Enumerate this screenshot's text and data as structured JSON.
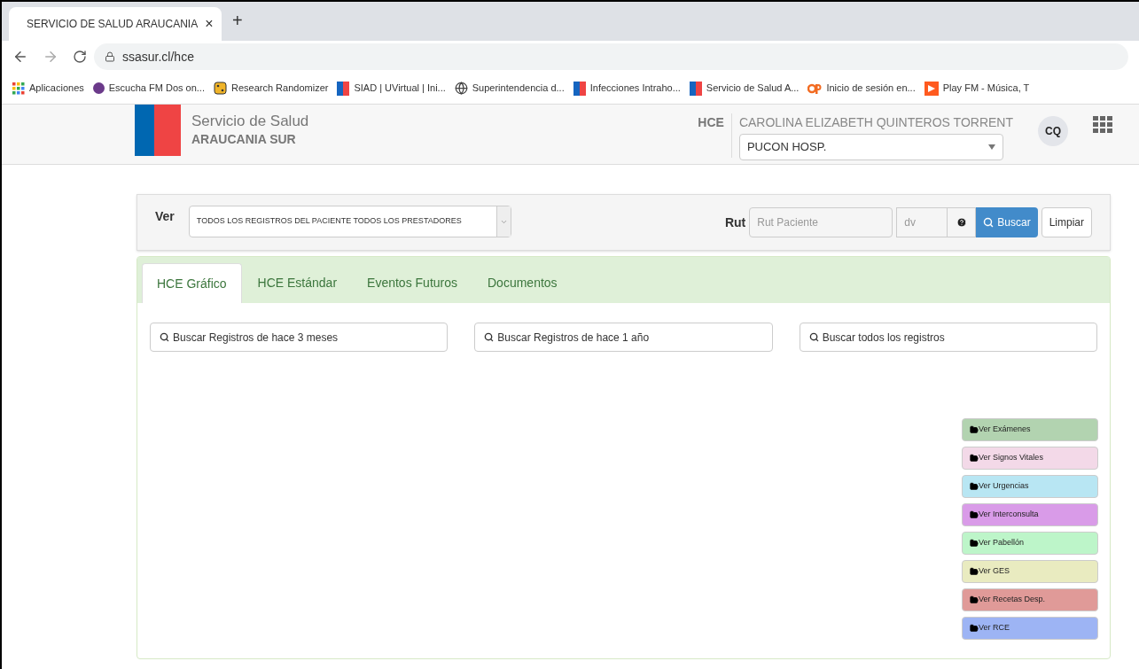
{
  "browser": {
    "tab": {
      "title": "SERVICIO DE SALUD ARAUCANIA",
      "close": "×"
    },
    "new_tab": "+",
    "url": "ssasur.cl/hce",
    "bookmarks": [
      {
        "label": "Aplicaciones",
        "kind": "apps"
      },
      {
        "label": "Escucha FM Dos on...",
        "kind": "circle"
      },
      {
        "label": "Research Randomizer",
        "kind": "dice"
      },
      {
        "label": "SIAD | UVirtual | Ini...",
        "kind": "flag"
      },
      {
        "label": "Superintendencia d...",
        "kind": "globe"
      },
      {
        "label": "Infecciones Intraho...",
        "kind": "flag"
      },
      {
        "label": "Servicio de Salud A...",
        "kind": "flag"
      },
      {
        "label": "Inicio de sesión en...",
        "kind": "cp"
      },
      {
        "label": "Play FM - Música, T",
        "kind": "play"
      }
    ]
  },
  "header": {
    "org_line1": "Servicio de Salud",
    "org_line2": "ARAUCANIA SUR",
    "module": "HCE",
    "user": "CAROLINA ELIZABETH QUINTEROS TORRENT",
    "establishment": "PUCON HOSP.",
    "avatar": "CQ"
  },
  "filter": {
    "ver_label": "Ver",
    "ver_value": "TODOS LOS REGISTROS DEL PACIENTE TODOS LOS PRESTADORES",
    "rut_label": "Rut",
    "rut_placeholder": "Rut Paciente",
    "dv_placeholder": "dv",
    "search_button": "Buscar",
    "clear_button": "Limpiar"
  },
  "tabs": [
    {
      "label": "HCE Gráfico",
      "selected": true
    },
    {
      "label": "HCE Estándar",
      "selected": false
    },
    {
      "label": "Eventos Futuros",
      "selected": false
    },
    {
      "label": "Documentos",
      "selected": false
    }
  ],
  "range_buttons": [
    "Buscar Registros de hace 3 meses",
    "Buscar Registros de hace 1 año",
    "Buscar todos los registros"
  ],
  "record_buttons": [
    {
      "label": "Ver Exámenes",
      "color": "#b2d3b0"
    },
    {
      "label": "Ver Signos Vitales",
      "color": "#f3d9e8"
    },
    {
      "label": "Ver Urgencias",
      "color": "#b8e6f3"
    },
    {
      "label": "Ver Interconsulta",
      "color": "#d99be8"
    },
    {
      "label": "Ver Pabellón",
      "color": "#bdf5c9"
    },
    {
      "label": "Ver GES",
      "color": "#e9ebc0"
    },
    {
      "label": "Ver Recetas Desp.",
      "color": "#e09a98"
    },
    {
      "label": "Ver RCE",
      "color": "#9db4f4"
    }
  ]
}
